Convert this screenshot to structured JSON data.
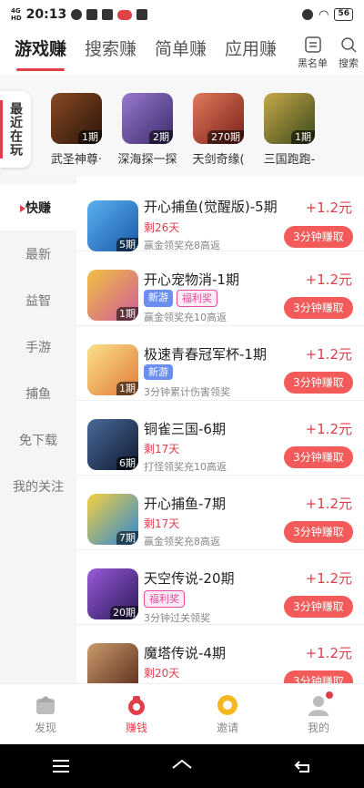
{
  "status_bar": {
    "network": "4G",
    "signal": "HD",
    "time": "20:13",
    "battery": "56"
  },
  "top_tabs": [
    {
      "label": "游戏赚",
      "active": true
    },
    {
      "label": "搜索赚",
      "active": false
    },
    {
      "label": "简单赚",
      "active": false
    },
    {
      "label": "应用赚",
      "active": false
    }
  ],
  "top_actions": {
    "blacklist_label": "黑名单",
    "search_label": "搜索"
  },
  "recent": {
    "label": "最近在玩",
    "items": [
      {
        "name": "武圣神尊·",
        "badge": "1期",
        "color": "#4a2a18"
      },
      {
        "name": "深海探一探",
        "badge": "2期",
        "color": "#6b4e9b"
      },
      {
        "name": "天剑奇缘(",
        "badge": "270期",
        "color": "#b5433a"
      },
      {
        "name": "三国跑跑-",
        "badge": "1期",
        "color": "#7a6a2a"
      }
    ]
  },
  "sidebar": {
    "items": [
      {
        "label": "快赚",
        "active": true
      },
      {
        "label": "最新",
        "active": false
      },
      {
        "label": "益智",
        "active": false
      },
      {
        "label": "手游",
        "active": false
      },
      {
        "label": "捕鱼",
        "active": false
      },
      {
        "label": "免下载",
        "active": false
      },
      {
        "label": "我的关注",
        "active": false
      }
    ]
  },
  "tasks": [
    {
      "title": "开心捕鱼(觉醒版)-5期",
      "reward": "+1.2元",
      "period": "5期",
      "remaining": "剩26天",
      "tags": [],
      "desc": "赢金领奖充8高返",
      "button": "3分钟赚取",
      "color": "#3d8fd8"
    },
    {
      "title": "开心宠物消-1期",
      "reward": "+1.2元",
      "period": "1期",
      "remaining": "",
      "tags": [
        "新游",
        "福利奖"
      ],
      "desc": "赢金领奖充10高返",
      "button": "3分钟赚取",
      "color": "#e8a02a"
    },
    {
      "title": "极速青春冠军杯-1期",
      "reward": "+1.2元",
      "period": "1期",
      "remaining": "",
      "tags": [
        "新游"
      ],
      "desc": "3分钟累计伤害领奖",
      "button": "3分钟赚取",
      "color": "#e5b64a"
    },
    {
      "title": "铜雀三国-6期",
      "reward": "+1.2元",
      "period": "6期",
      "remaining": "剩17天",
      "tags": [],
      "desc": "打怪领奖充10高返",
      "button": "3分钟赚取",
      "color": "#2c3f6a"
    },
    {
      "title": "开心捕鱼-7期",
      "reward": "+1.2元",
      "period": "7期",
      "remaining": "剩17天",
      "tags": [],
      "desc": "赢金领奖充8高返",
      "button": "3分钟赚取",
      "color": "#2f86d6"
    },
    {
      "title": "天空传说-20期",
      "reward": "+1.2元",
      "period": "20期",
      "remaining": "",
      "tags": [
        "福利奖"
      ],
      "desc": "3分钟过关领奖",
      "button": "3分钟赚取",
      "color": "#6c3aa8"
    },
    {
      "title": "魔塔传说-4期",
      "reward": "+1.2元",
      "period": "",
      "remaining": "剩20天",
      "tags": [],
      "desc": "",
      "button": "3分钟赚取",
      "color": "#8a5a3a"
    }
  ],
  "bottom_nav": [
    {
      "label": "发现",
      "active": false,
      "icon": "discover-icon"
    },
    {
      "label": "赚钱",
      "active": true,
      "icon": "money-bag-icon"
    },
    {
      "label": "邀请",
      "active": false,
      "icon": "coin-icon"
    },
    {
      "label": "我的",
      "active": false,
      "icon": "profile-icon"
    }
  ],
  "colors": {
    "accent": "#e23d4b",
    "button": "#f35a5a",
    "tag_new": "#6b8ff0",
    "tag_bonus": "#e54b9e"
  }
}
